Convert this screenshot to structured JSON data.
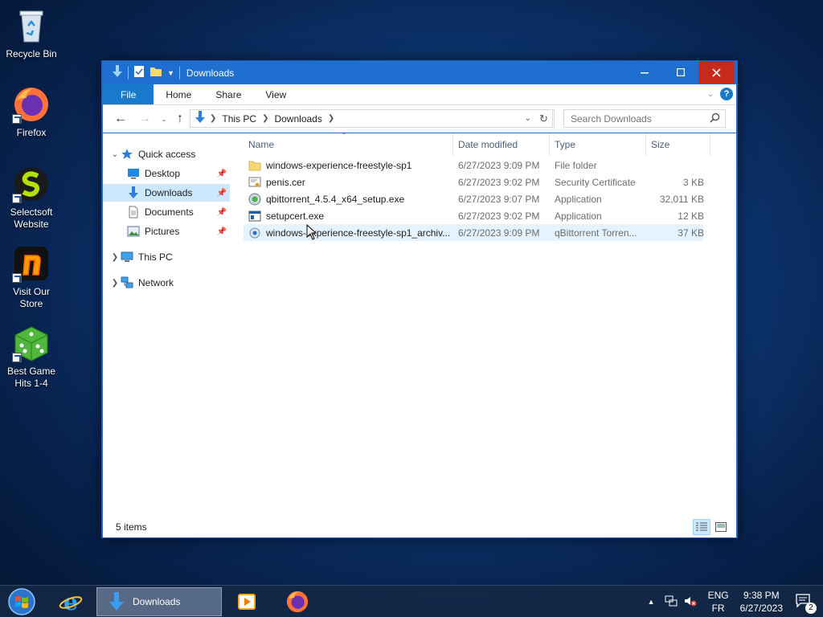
{
  "desktop": {
    "icons": [
      {
        "label": "Recycle Bin"
      },
      {
        "label": "Firefox"
      },
      {
        "label": "Selectsoft Website"
      },
      {
        "label": "Visit Our Store"
      },
      {
        "label": "Best Game Hits 1-4"
      }
    ]
  },
  "window": {
    "title": "Downloads",
    "ribbon_tabs": [
      "File",
      "Home",
      "Share",
      "View"
    ],
    "address": {
      "crumbs": [
        "This PC",
        "Downloads"
      ]
    },
    "search": {
      "placeholder": "Search Downloads"
    },
    "nav": {
      "quick_access": "Quick access",
      "items": [
        {
          "label": "Desktop",
          "icon": "desktop-icon"
        },
        {
          "label": "Downloads",
          "icon": "downloads-icon"
        },
        {
          "label": "Documents",
          "icon": "documents-icon"
        },
        {
          "label": "Pictures",
          "icon": "pictures-icon"
        }
      ],
      "this_pc": "This PC",
      "network": "Network"
    },
    "columns": [
      "Name",
      "Date modified",
      "Type",
      "Size"
    ],
    "files": [
      {
        "name": "windows-experience-freestyle-sp1",
        "date": "6/27/2023 9:09 PM",
        "type": "File folder",
        "size": "",
        "icon": "folder-icon"
      },
      {
        "name": "penis.cer",
        "date": "6/27/2023 9:02 PM",
        "type": "Security Certificate",
        "size": "3 KB",
        "icon": "certificate-icon"
      },
      {
        "name": "qbittorrent_4.5.4_x64_setup.exe",
        "date": "6/27/2023 9:07 PM",
        "type": "Application",
        "size": "32,011 KB",
        "icon": "installer-icon"
      },
      {
        "name": "setupcert.exe",
        "date": "6/27/2023 9:02 PM",
        "type": "Application",
        "size": "12 KB",
        "icon": "application-icon"
      },
      {
        "name": "windows-experience-freestyle-sp1_archiv...",
        "date": "6/27/2023 9:09 PM",
        "type": "qBittorrent Torren...",
        "size": "37 KB",
        "icon": "torrent-icon"
      }
    ],
    "status": "5 items"
  },
  "taskbar": {
    "active_label": "Downloads",
    "lang_top": "ENG",
    "lang_bottom": "FR",
    "time": "9:38 PM",
    "date": "6/27/2023",
    "notification_count": "2"
  }
}
